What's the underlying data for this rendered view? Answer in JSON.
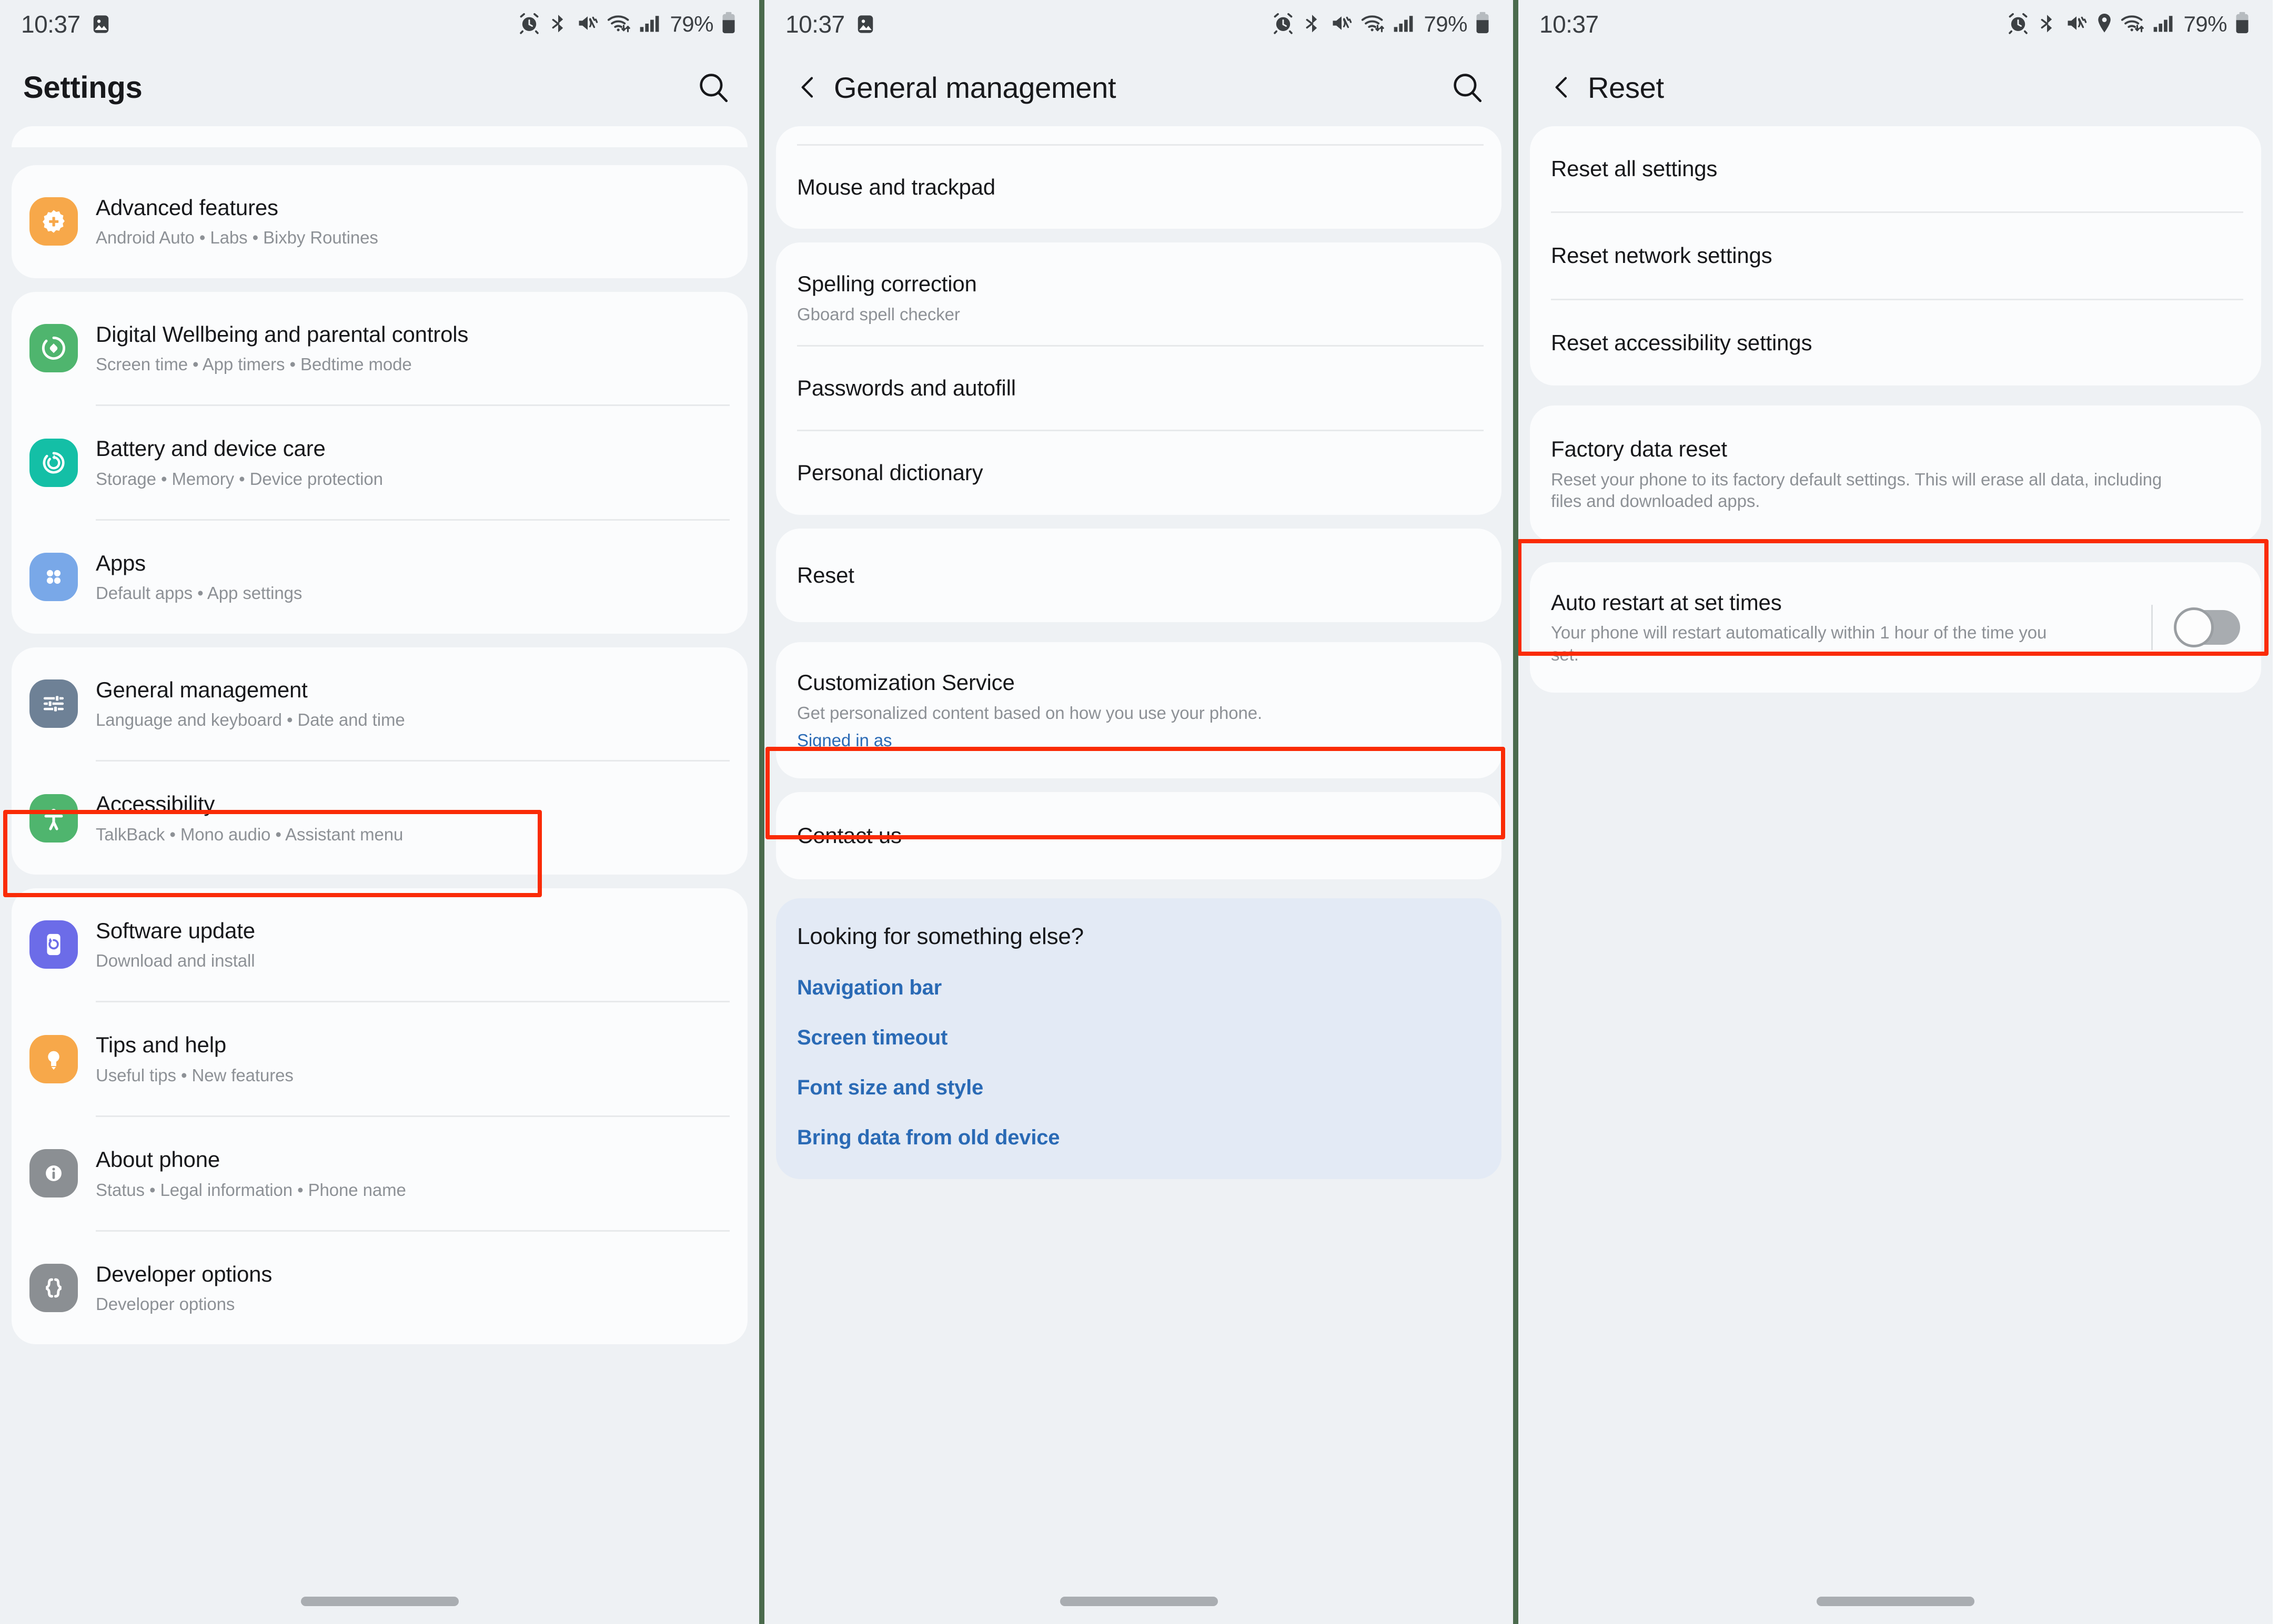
{
  "colors": {
    "bg": "#eef1f4",
    "card": "#fbfcfd",
    "tinted_card": "#e3eaf5",
    "highlight": "#fa2b06",
    "link_blue": "#2a6ab5",
    "divider_green": "#4b6b4d",
    "icon_advanced": "#f7a84a",
    "icon_wellbeing": "#4fb56e",
    "icon_battery": "#14bfa6",
    "icon_apps": "#79a8e8",
    "icon_general": "#6e8196",
    "icon_accessibility": "#4fb56e",
    "icon_software": "#6c6ce8",
    "icon_tips": "#f7a84a",
    "icon_about": "#8b8f93",
    "icon_developer": "#8b8f93"
  },
  "statusbar": {
    "time": "10:37",
    "battery_percent": "79%",
    "icons_p1": [
      "gallery-icon",
      "alarm-icon",
      "bluetooth-icon",
      "mute-vibrate-icon",
      "wifi-icon",
      "signal-icon",
      "battery-icon"
    ],
    "icons_p2": [
      "gallery-icon",
      "alarm-icon",
      "bluetooth-icon",
      "mute-vibrate-icon",
      "wifi-icon",
      "signal-icon",
      "battery-icon"
    ],
    "icons_p3": [
      "alarm-icon",
      "bluetooth-icon",
      "mute-vibrate-icon",
      "location-icon",
      "wifi-icon",
      "signal-icon",
      "battery-icon"
    ]
  },
  "panel1": {
    "title": "Settings",
    "search_icon": "search-icon",
    "items": [
      {
        "title": "Advanced features",
        "subtitle": "Android Auto  •  Labs  •  Bixby Routines",
        "icon": "advanced-features-icon"
      },
      {
        "title": "Digital Wellbeing and parental controls",
        "subtitle": "Screen time  •  App timers  •  Bedtime mode",
        "icon": "digital-wellbeing-icon"
      },
      {
        "title": "Battery and device care",
        "subtitle": "Storage  •  Memory  •  Device protection",
        "icon": "battery-device-care-icon"
      },
      {
        "title": "Apps",
        "subtitle": "Default apps  •  App settings",
        "icon": "apps-icon"
      },
      {
        "title": "General management",
        "subtitle": "Language and keyboard  •  Date and time",
        "icon": "general-management-icon"
      },
      {
        "title": "Accessibility",
        "subtitle": "TalkBack  •  Mono audio  •  Assistant menu",
        "icon": "accessibility-icon"
      },
      {
        "title": "Software update",
        "subtitle": "Download and install",
        "icon": "software-update-icon"
      },
      {
        "title": "Tips and help",
        "subtitle": "Useful tips  •  New features",
        "icon": "tips-help-icon"
      },
      {
        "title": "About phone",
        "subtitle": "Status  •  Legal information  •  Phone name",
        "icon": "about-phone-icon"
      },
      {
        "title": "Developer options",
        "subtitle": "Developer options",
        "icon": "developer-options-icon"
      }
    ],
    "highlighted_item": "General management"
  },
  "panel2": {
    "title": "General management",
    "back_icon": "back-arrow-icon",
    "search_icon": "search-icon",
    "items": [
      {
        "title": "Mouse and trackpad",
        "subtitle": ""
      },
      {
        "title": "Spelling correction",
        "subtitle": "Gboard spell checker"
      },
      {
        "title": "Passwords and autofill",
        "subtitle": ""
      },
      {
        "title": "Personal dictionary",
        "subtitle": ""
      },
      {
        "title": "Reset",
        "subtitle": ""
      },
      {
        "title": "Customization Service",
        "subtitle": "Get personalized content based on how you use your phone.",
        "link": "Signed in as"
      },
      {
        "title": "Contact us",
        "subtitle": ""
      }
    ],
    "highlighted_item": "Reset",
    "looking_for": {
      "heading": "Looking for something else?",
      "links": [
        "Navigation bar",
        "Screen timeout",
        "Font size and style",
        "Bring data from old device"
      ]
    }
  },
  "panel3": {
    "title": "Reset",
    "back_icon": "back-arrow-icon",
    "items": [
      {
        "title": "Reset all settings",
        "subtitle": ""
      },
      {
        "title": "Reset network settings",
        "subtitle": ""
      },
      {
        "title": "Reset accessibility settings",
        "subtitle": ""
      }
    ],
    "factory": {
      "title": "Factory data reset",
      "subtitle": "Reset your phone to its factory default settings. This will erase all data, including files and downloaded apps."
    },
    "auto_restart": {
      "title": "Auto restart at set times",
      "subtitle": "Your phone will restart automatically within 1 hour of the time you set.",
      "toggle_state": "off"
    },
    "highlighted_item": "Factory data reset"
  }
}
